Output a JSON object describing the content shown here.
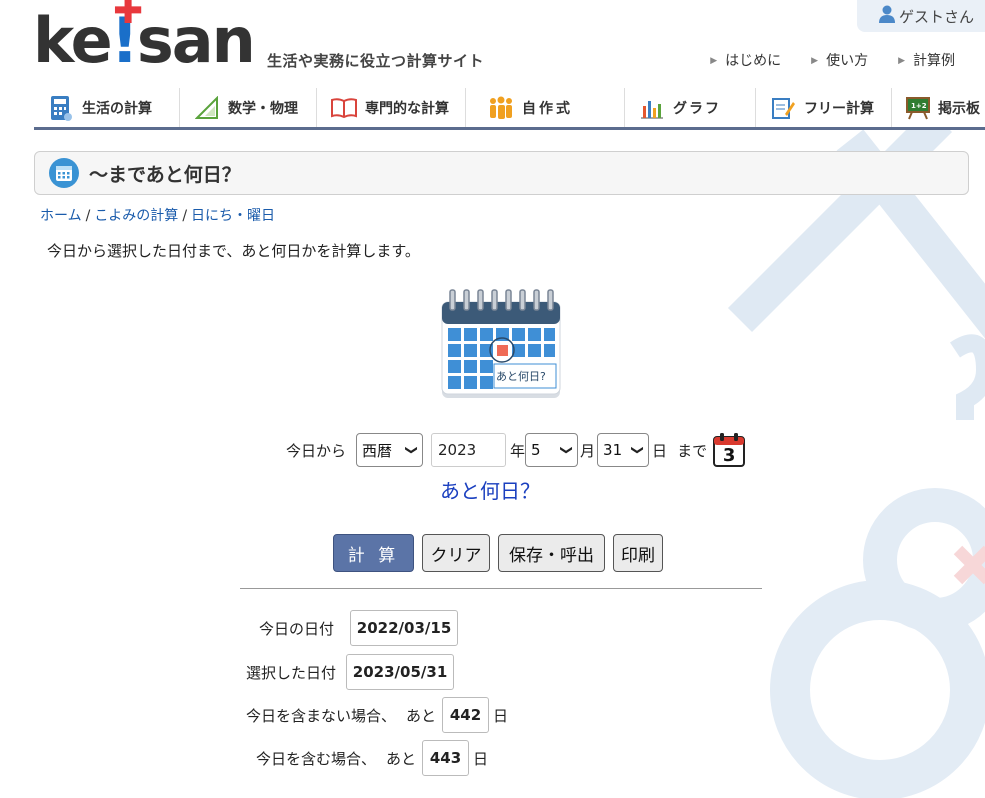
{
  "header": {
    "logo_text": "ke!san",
    "tagline": "生活や実務に役立つ計算サイト",
    "guest_label": "ゲストさん",
    "top_links": [
      "はじめに",
      "使い方",
      "計算例"
    ]
  },
  "nav": {
    "items": [
      {
        "label": "生活の計算",
        "icon": "calculator-icon"
      },
      {
        "label": "数学・物理",
        "icon": "triangle-ruler-icon"
      },
      {
        "label": "専門的な計算",
        "icon": "open-book-icon"
      },
      {
        "label": "自作式",
        "icon": "people-icon"
      },
      {
        "label": "グラフ",
        "icon": "bar-chart-icon"
      },
      {
        "label": "フリー計算",
        "icon": "notepad-pencil-icon"
      },
      {
        "label": "掲示板",
        "icon": "chalkboard-icon"
      }
    ]
  },
  "page": {
    "title": "～まであと何日？",
    "breadcrumb": [
      "ホーム",
      "こよみの計算",
      "日にち・曜日"
    ],
    "description": "今日から選択した日付まで、あと何日かを計算します。",
    "illustration_label": "あと何日?"
  },
  "form": {
    "prefix": "今日から",
    "era_value": "西暦",
    "year_value": "2023",
    "year_unit": "年",
    "month_value": "5",
    "month_unit": "月",
    "day_value": "31",
    "day_unit": "日",
    "suffix": "まで",
    "calendar_icon_label": "3",
    "question": "あと何日？"
  },
  "buttons": {
    "calculate": "計 算",
    "clear": "クリア",
    "save": "保存・呼出",
    "print": "印刷"
  },
  "results": {
    "today_label": "今日の日付",
    "today_value": "2022/03/15",
    "selected_label": "選択した日付",
    "selected_value": "2023/05/31",
    "exclusive_label": "今日を含まない場合、",
    "exclusive_prefix": "あと",
    "exclusive_value": "442",
    "exclusive_unit": "日",
    "inclusive_label": "今日を含む場合、",
    "inclusive_prefix": "あと",
    "inclusive_value": "443",
    "inclusive_unit": "日"
  },
  "colors": {
    "accent": "#5b74a7",
    "link": "#1a5bab",
    "logo_red": "#e8383d",
    "logo_blue": "#1a6fc9"
  }
}
